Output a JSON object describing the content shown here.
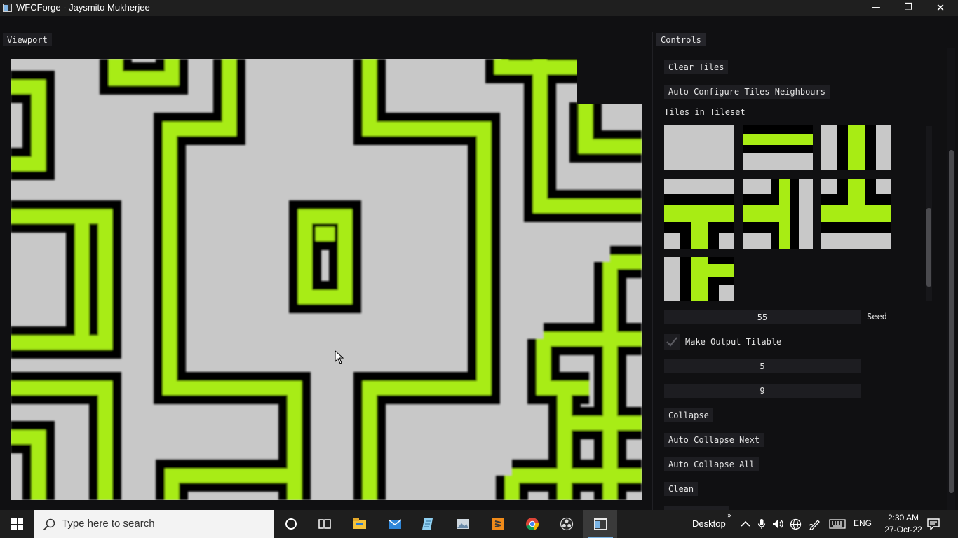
{
  "window": {
    "title": "WFCForge - Jaysmito Mukherjee",
    "minimize_glyph": "—",
    "maximize_glyph": "❐",
    "close_glyph": "✕"
  },
  "viewport": {
    "tab_label": "Viewport"
  },
  "controls": {
    "tab_label": "Controls",
    "clear_tiles_label": "Clear Tiles",
    "auto_configure_label": "Auto Configure Tiles Neighbours",
    "tiles_heading": "Tiles in Tileset",
    "tiles": [
      "blank",
      "horizontal-bar",
      "vertical-bar",
      "t-down",
      "t-right",
      "t-up",
      "corner"
    ],
    "seed_value": "55",
    "seed_label": "Seed",
    "make_tilable_checked": true,
    "make_tilable_label": "Make Output Tilable",
    "width_value": "5",
    "height_value": "9",
    "collapse_label": "Collapse",
    "auto_collapse_next_label": "Auto Collapse Next",
    "auto_collapse_all_label": "Auto Collapse All",
    "clean_label": "Clean"
  },
  "colors": {
    "accent_green": "#a8ec14",
    "tile_gray": "#c8c8c8",
    "panel_bg": "#101012",
    "button_bg": "#1e1e22"
  },
  "taskbar": {
    "search_placeholder": "Type here to search",
    "pinned": [
      "cortana-icon",
      "task-view-icon",
      "file-explorer-icon",
      "mail-icon",
      "notepad-icon",
      "photos-icon",
      "sublime-text-icon",
      "chrome-icon",
      "obs-icon",
      "wfcforge-icon"
    ],
    "desktop_label": "Desktop",
    "desktop_chevron": "»",
    "language": "ENG",
    "time": "2:30 AM",
    "date": "27-Oct-22"
  }
}
